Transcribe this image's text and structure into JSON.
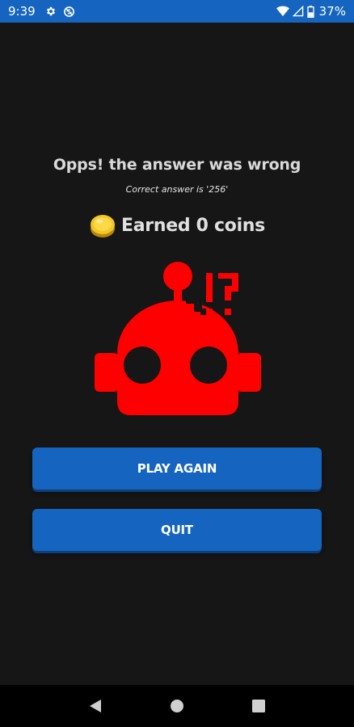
{
  "status_bar": {
    "time": "9:39",
    "battery_text": "37%",
    "left_icons": [
      "settings-icon",
      "no-sync-icon"
    ],
    "right_icons": [
      "wifi-icon",
      "signal-icon",
      "battery-icon"
    ],
    "background": "#1565c0"
  },
  "result": {
    "title": "Opps! the answer was wrong",
    "correct_answer": "Correct answer is '256'",
    "earned_text": "Earned 0 coins",
    "coin_icon": "coin-icon",
    "robot_icon": "confused-robot-icon",
    "robot_color": "#ff0000"
  },
  "buttons": {
    "play_again": "PLAY AGAIN",
    "quit": "QUIT",
    "color": "#1565c0"
  },
  "nav_bar": {
    "icons": [
      "back-icon",
      "home-icon",
      "recents-icon"
    ]
  }
}
